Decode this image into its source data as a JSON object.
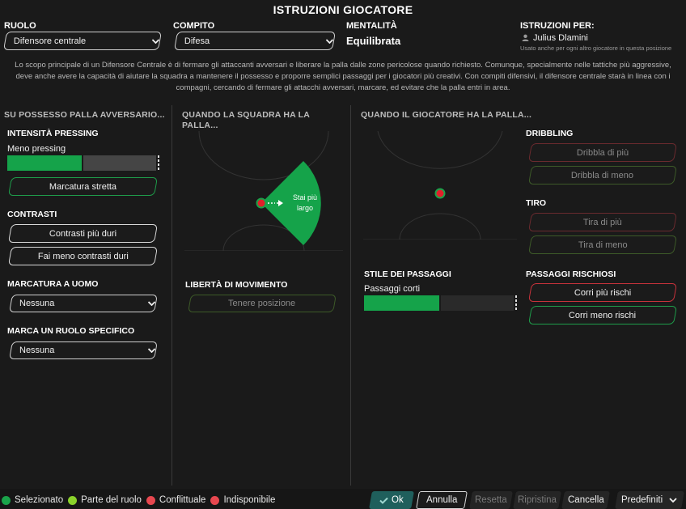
{
  "window": {
    "title": "ISTRUZIONI GIOCATORE"
  },
  "header": {
    "ruolo_label": "RUOLO",
    "ruolo_value": "Difensore centrale",
    "compito_label": "COMPITO",
    "compito_value": "Difesa",
    "mentalita_label": "MENTALITÀ",
    "mentalita_value": "Equilibrata",
    "istruzioni_label": "ISTRUZIONI PER:",
    "player_name": "Julius Dlamini",
    "player_note": "Usato anche per ogni altro giocatore in questa posizione"
  },
  "description": "Lo scopo principale di un Difensore Centrale è di fermare gli attaccanti avversari e liberare la palla dalle zone pericolose quando richiesto. Comunque, specialmente nelle tattiche più aggressive, deve anche avere la capacità di aiutare la squadra a mantenere il possesso e proporre semplici passaggi per i giocatori più creativi. Con compiti difensivi, il difensore centrale starà in linea con i compagni, cercando di fermare gli attacchi avversari, marcare, ed evitare che la palla entri in area.",
  "col1": {
    "title": "SU POSSESSO PALLA AVVERSARIO...",
    "pressing_title": "INTENSITÀ PRESSING",
    "pressing_value_label": "Meno pressing",
    "pressing_level": 0.5,
    "marcatura_stretta": "Marcatura stretta",
    "contrasti_title": "CONTRASTI",
    "contrasti_piu": "Contrasti più duri",
    "contrasti_meno": "Fai meno contrasti duri",
    "uomo_title": "MARCATURA A UOMO",
    "uomo_value": "Nessuna",
    "ruolo_spec_title": "MARCA UN RUOLO SPECIFICO",
    "ruolo_spec_value": "Nessuna"
  },
  "col2": {
    "title_line1": "QUANDO LA SQUADRA HA LA",
    "title_line2": "PALLA...",
    "pitch_label_line1": "Stai più",
    "pitch_label_line2": "largo",
    "liberta_title": "LIBERTÀ DI MOVIMENTO",
    "tenere_posizione": "Tenere posizione"
  },
  "col3": {
    "title": "QUANDO IL GIOCATORE HA LA PALLA...",
    "dribbling_title": "DRIBBLING",
    "dribbla_piu": "Dribbla di più",
    "dribbla_meno": "Dribbla di meno",
    "tiro_title": "TIRO",
    "tira_piu": "Tira di più",
    "tira_meno": "Tira di meno",
    "stile_title": "STILE DEI PASSAGGI",
    "stile_value_label": "Passaggi corti",
    "stile_level": 0.5,
    "rischiosi_title": "PASSAGGI RISCHIOSI",
    "corri_piu": "Corri più rischi",
    "corri_meno": "Corri meno rischi"
  },
  "legend": {
    "selezionato": "Selezionato",
    "parte_ruolo": "Parte del ruolo",
    "conflittuale": "Conflittuale",
    "indisponibile": "Indisponibile",
    "colors": {
      "selezionato": "#1aa34a",
      "parte_ruolo": "#8bd22b",
      "conflittuale": "#e8474f",
      "indisponibile": "#e8474f"
    }
  },
  "footer": {
    "ok": "Ok",
    "annulla": "Annulla",
    "resetta": "Resetta",
    "ripristina": "Ripristina",
    "cancella": "Cancella",
    "predefiniti": "Predefiniti"
  },
  "colors": {
    "accent_green": "#15a34a",
    "conflict_red": "#c8323b",
    "ok_teal": "#1f5f5c"
  }
}
